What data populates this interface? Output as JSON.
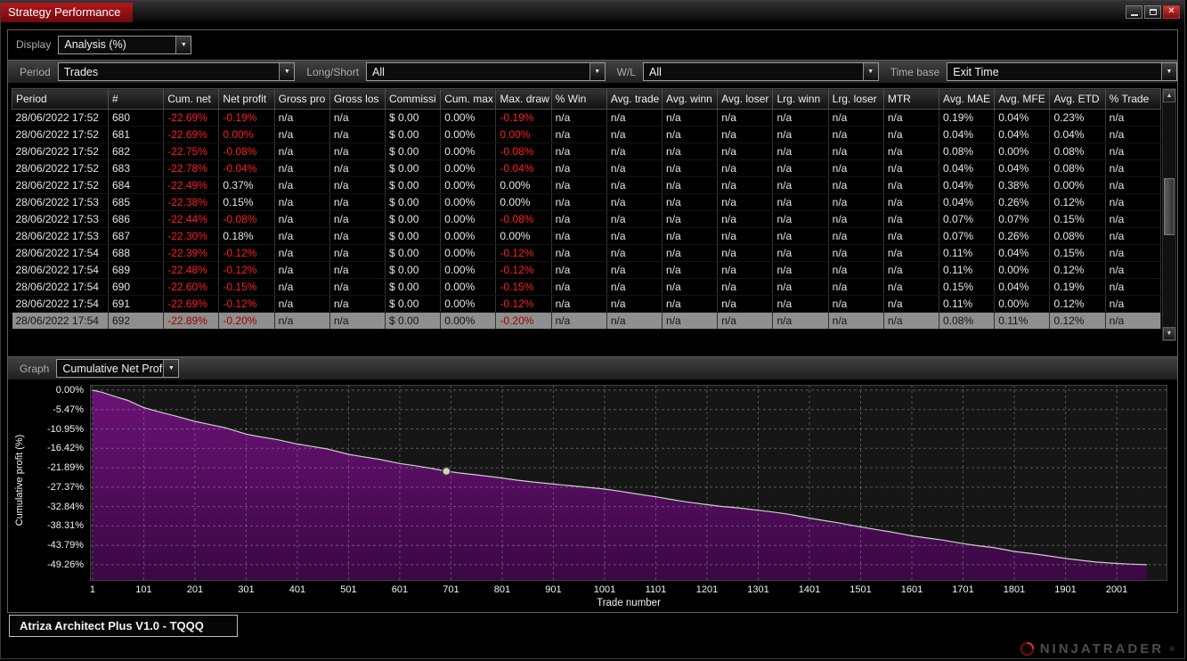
{
  "window": {
    "title": "Strategy Performance"
  },
  "display": {
    "label": "Display",
    "value": "Analysis (%)"
  },
  "filters": {
    "period_label": "Period",
    "period_value": "Trades",
    "long_short_label": "Long/Short",
    "long_short_value": "All",
    "wl_label": "W/L",
    "wl_value": "All",
    "time_base_label": "Time base",
    "time_base_value": "Exit Time"
  },
  "table": {
    "columns": [
      "Period",
      "#",
      "Cum. net",
      "Net profit",
      "Gross pro",
      "Gross los",
      "Commissi",
      "Cum. max",
      "Max. draw",
      "% Win",
      "Avg. trade",
      "Avg. winn",
      "Avg. loser",
      "Lrg. winn",
      "Lrg. loser",
      "MTR",
      "Avg. MAE",
      "Avg. MFE",
      "Avg. ETD",
      "% Trade"
    ],
    "rows": [
      {
        "cells": [
          "28/06/2022 17:52",
          "680",
          "-22.69%",
          "-0.19%",
          "n/a",
          "n/a",
          "$ 0.00",
          "0.00%",
          "-0.19%",
          "n/a",
          "n/a",
          "n/a",
          "n/a",
          "n/a",
          "n/a",
          "n/a",
          "0.19%",
          "0.04%",
          "0.23%",
          "n/a"
        ],
        "red": [
          2,
          3,
          8
        ]
      },
      {
        "cells": [
          "28/06/2022 17:52",
          "681",
          "-22.69%",
          "0.00%",
          "n/a",
          "n/a",
          "$ 0.00",
          "0.00%",
          "0.00%",
          "n/a",
          "n/a",
          "n/a",
          "n/a",
          "n/a",
          "n/a",
          "n/a",
          "0.04%",
          "0.04%",
          "0.04%",
          "n/a"
        ],
        "red": [
          2,
          3,
          8
        ]
      },
      {
        "cells": [
          "28/06/2022 17:52",
          "682",
          "-22.75%",
          "-0.08%",
          "n/a",
          "n/a",
          "$ 0.00",
          "0.00%",
          "-0.08%",
          "n/a",
          "n/a",
          "n/a",
          "n/a",
          "n/a",
          "n/a",
          "n/a",
          "0.08%",
          "0.00%",
          "0.08%",
          "n/a"
        ],
        "red": [
          2,
          3,
          8
        ]
      },
      {
        "cells": [
          "28/06/2022 17:52",
          "683",
          "-22.78%",
          "-0.04%",
          "n/a",
          "n/a",
          "$ 0.00",
          "0.00%",
          "-0.04%",
          "n/a",
          "n/a",
          "n/a",
          "n/a",
          "n/a",
          "n/a",
          "n/a",
          "0.04%",
          "0.04%",
          "0.08%",
          "n/a"
        ],
        "red": [
          2,
          3,
          8
        ]
      },
      {
        "cells": [
          "28/06/2022 17:52",
          "684",
          "-22.49%",
          "0.37%",
          "n/a",
          "n/a",
          "$ 0.00",
          "0.00%",
          "0.00%",
          "n/a",
          "n/a",
          "n/a",
          "n/a",
          "n/a",
          "n/a",
          "n/a",
          "0.04%",
          "0.38%",
          "0.00%",
          "n/a"
        ],
        "red": [
          2
        ]
      },
      {
        "cells": [
          "28/06/2022 17:53",
          "685",
          "-22.38%",
          "0.15%",
          "n/a",
          "n/a",
          "$ 0.00",
          "0.00%",
          "0.00%",
          "n/a",
          "n/a",
          "n/a",
          "n/a",
          "n/a",
          "n/a",
          "n/a",
          "0.04%",
          "0.26%",
          "0.12%",
          "n/a"
        ],
        "red": [
          2
        ]
      },
      {
        "cells": [
          "28/06/2022 17:53",
          "686",
          "-22.44%",
          "-0.08%",
          "n/a",
          "n/a",
          "$ 0.00",
          "0.00%",
          "-0.08%",
          "n/a",
          "n/a",
          "n/a",
          "n/a",
          "n/a",
          "n/a",
          "n/a",
          "0.07%",
          "0.07%",
          "0.15%",
          "n/a"
        ],
        "red": [
          2,
          3,
          8
        ]
      },
      {
        "cells": [
          "28/06/2022 17:53",
          "687",
          "-22.30%",
          "0.18%",
          "n/a",
          "n/a",
          "$ 0.00",
          "0.00%",
          "0.00%",
          "n/a",
          "n/a",
          "n/a",
          "n/a",
          "n/a",
          "n/a",
          "n/a",
          "0.07%",
          "0.26%",
          "0.08%",
          "n/a"
        ],
        "red": [
          2
        ]
      },
      {
        "cells": [
          "28/06/2022 17:54",
          "688",
          "-22.39%",
          "-0.12%",
          "n/a",
          "n/a",
          "$ 0.00",
          "0.00%",
          "-0.12%",
          "n/a",
          "n/a",
          "n/a",
          "n/a",
          "n/a",
          "n/a",
          "n/a",
          "0.11%",
          "0.04%",
          "0.15%",
          "n/a"
        ],
        "red": [
          2,
          3,
          8
        ]
      },
      {
        "cells": [
          "28/06/2022 17:54",
          "689",
          "-22.48%",
          "-0.12%",
          "n/a",
          "n/a",
          "$ 0.00",
          "0.00%",
          "-0.12%",
          "n/a",
          "n/a",
          "n/a",
          "n/a",
          "n/a",
          "n/a",
          "n/a",
          "0.11%",
          "0.00%",
          "0.12%",
          "n/a"
        ],
        "red": [
          2,
          3,
          8
        ]
      },
      {
        "cells": [
          "28/06/2022 17:54",
          "690",
          "-22.60%",
          "-0.15%",
          "n/a",
          "n/a",
          "$ 0.00",
          "0.00%",
          "-0.15%",
          "n/a",
          "n/a",
          "n/a",
          "n/a",
          "n/a",
          "n/a",
          "n/a",
          "0.15%",
          "0.04%",
          "0.19%",
          "n/a"
        ],
        "red": [
          2,
          3,
          8
        ]
      },
      {
        "cells": [
          "28/06/2022 17:54",
          "691",
          "-22.69%",
          "-0.12%",
          "n/a",
          "n/a",
          "$ 0.00",
          "0.00%",
          "-0.12%",
          "n/a",
          "n/a",
          "n/a",
          "n/a",
          "n/a",
          "n/a",
          "n/a",
          "0.11%",
          "0.00%",
          "0.12%",
          "n/a"
        ],
        "red": [
          2,
          3,
          8
        ]
      },
      {
        "cells": [
          "28/06/2022 17:54",
          "692",
          "-22.89%",
          "-0.20%",
          "n/a",
          "n/a",
          "$ 0.00",
          "0.00%",
          "-0.20%",
          "n/a",
          "n/a",
          "n/a",
          "n/a",
          "n/a",
          "n/a",
          "n/a",
          "0.08%",
          "0.11%",
          "0.12%",
          "n/a"
        ],
        "red": [
          2,
          3,
          8
        ],
        "selected": true
      }
    ]
  },
  "graph": {
    "label": "Graph",
    "value": "Cumulative Net Profit"
  },
  "chart_data": {
    "type": "area",
    "title": "Cumulative Net Profit",
    "xlabel": "Trade number",
    "ylabel": "Cumulative profit (%)",
    "xlim": [
      -4,
      2100
    ],
    "ylim": [
      -53.8,
      1.5
    ],
    "x_ticks": [
      1,
      101,
      201,
      301,
      401,
      501,
      601,
      701,
      801,
      901,
      1001,
      1101,
      1201,
      1301,
      1401,
      1501,
      1601,
      1701,
      1801,
      1901,
      2001
    ],
    "y_ticks": [
      0,
      -5.47,
      -10.95,
      -16.42,
      -21.89,
      -27.37,
      -32.84,
      -38.31,
      -43.79,
      -49.26
    ],
    "y_tick_labels": [
      "0.00%",
      "-5.47%",
      "-10.95%",
      "-16.42%",
      "-21.89%",
      "-27.37%",
      "-32.84%",
      "-38.31%",
      "-43.79%",
      "-49.26%"
    ],
    "grid": true,
    "legend": false,
    "series": [
      {
        "name": "Cumulative Net Profit",
        "points": [
          [
            1,
            0
          ],
          [
            20,
            -0.6
          ],
          [
            45,
            -1.8
          ],
          [
            70,
            -2.9
          ],
          [
            101,
            -4.9
          ],
          [
            130,
            -6.1
          ],
          [
            160,
            -7.2
          ],
          [
            201,
            -8.8
          ],
          [
            230,
            -9.7
          ],
          [
            260,
            -10.6
          ],
          [
            301,
            -12.4
          ],
          [
            330,
            -13.2
          ],
          [
            360,
            -13.9
          ],
          [
            401,
            -15.2
          ],
          [
            430,
            -15.9
          ],
          [
            460,
            -16.6
          ],
          [
            501,
            -18.1
          ],
          [
            530,
            -18.8
          ],
          [
            560,
            -19.5
          ],
          [
            601,
            -20.7
          ],
          [
            630,
            -21.3
          ],
          [
            660,
            -22.0
          ],
          [
            692,
            -22.89
          ],
          [
            720,
            -23.4
          ],
          [
            750,
            -23.9
          ],
          [
            801,
            -24.8
          ],
          [
            830,
            -25.4
          ],
          [
            860,
            -25.9
          ],
          [
            901,
            -26.5
          ],
          [
            930,
            -26.9
          ],
          [
            960,
            -27.3
          ],
          [
            1001,
            -27.9
          ],
          [
            1030,
            -28.5
          ],
          [
            1060,
            -29.2
          ],
          [
            1101,
            -30.1
          ],
          [
            1130,
            -30.8
          ],
          [
            1160,
            -31.5
          ],
          [
            1201,
            -32.3
          ],
          [
            1230,
            -32.8
          ],
          [
            1260,
            -33.2
          ],
          [
            1301,
            -33.9
          ],
          [
            1330,
            -34.4
          ],
          [
            1360,
            -35.0
          ],
          [
            1401,
            -36.1
          ],
          [
            1430,
            -36.8
          ],
          [
            1460,
            -37.5
          ],
          [
            1501,
            -38.6
          ],
          [
            1530,
            -39.3
          ],
          [
            1560,
            -40.0
          ],
          [
            1601,
            -41.1
          ],
          [
            1630,
            -41.7
          ],
          [
            1660,
            -42.3
          ],
          [
            1701,
            -43.3
          ],
          [
            1730,
            -43.9
          ],
          [
            1760,
            -44.4
          ],
          [
            1801,
            -45.5
          ],
          [
            1830,
            -46.0
          ],
          [
            1860,
            -46.6
          ],
          [
            1901,
            -47.5
          ],
          [
            1930,
            -48.0
          ],
          [
            1960,
            -48.5
          ],
          [
            2001,
            -48.9
          ],
          [
            2030,
            -49.1
          ],
          [
            2060,
            -49.26
          ]
        ]
      }
    ],
    "marker": {
      "x": 692,
      "y": -22.89
    },
    "colors": {
      "area_top": "#6b1277",
      "area_bottom": "#3a0843",
      "line": "#cccccc",
      "grid": "#9a9a9a",
      "plot_bg": "#161616",
      "negative": "#ff1e1e"
    }
  },
  "footer": {
    "tab_label": "Atriza Architect Plus V1.0 - TQQQ"
  },
  "brand": {
    "name": "NINJATRADER",
    "registered": "®"
  }
}
